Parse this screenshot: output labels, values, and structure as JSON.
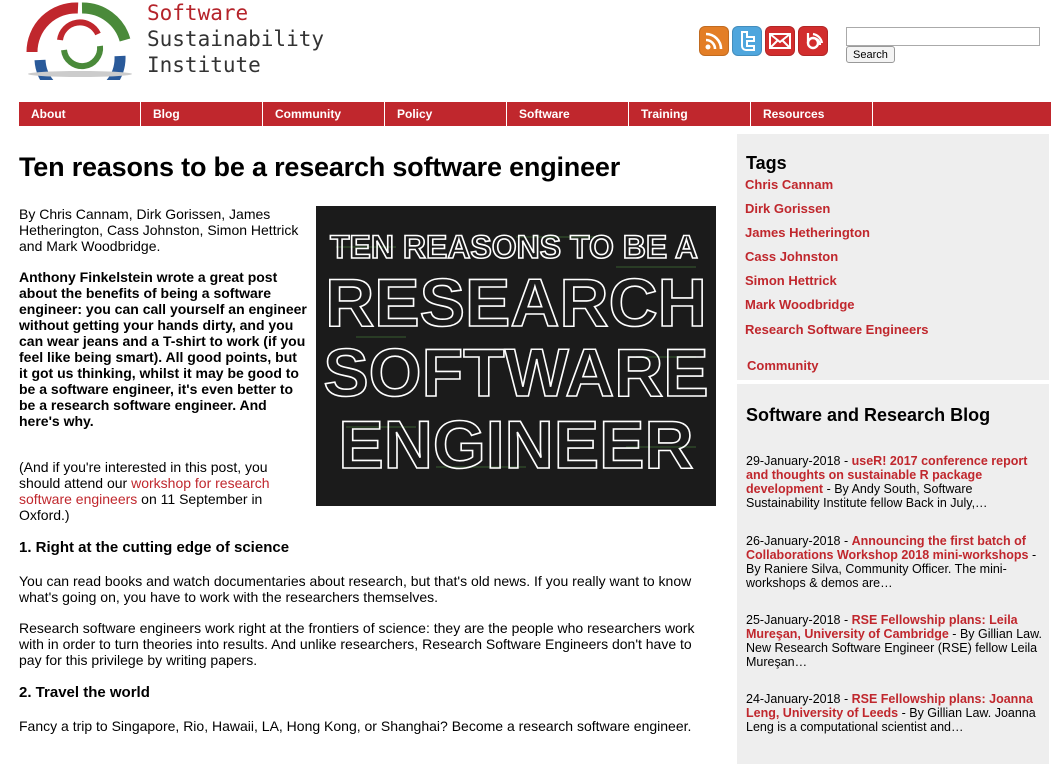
{
  "site": {
    "name_line1": "Software",
    "name_line2": "Sustainability",
    "name_line3": "Institute"
  },
  "social": [
    {
      "icon": "rss-icon",
      "color": "#e37e26"
    },
    {
      "icon": "twitter-icon",
      "color": "#4fa6dd"
    },
    {
      "icon": "email-icon",
      "color": "#d22d2d"
    },
    {
      "icon": "blog-icon",
      "color": "#d22d2d"
    }
  ],
  "search": {
    "placeholder": "",
    "button_label": "Search"
  },
  "nav": [
    "About",
    "Blog",
    "Community",
    "Policy",
    "Software",
    "Training",
    "Resources"
  ],
  "article": {
    "title": "Ten reasons to be a research software engineer",
    "byline": "By Chris Cannam, Dirk Gorissen, James Hetherington, Cass Johnston, Simon Hettrick and Mark Woodbridge.",
    "intro": "Anthony Finkelstein wrote a great post about the benefits of being a software engineer: you can call yourself an engineer without getting your hands dirty, and you can wear jeans and a T-shirt to work (if you feel like being smart). All good points, but it got us thinking, whilst it may be good to be a software engineer, it's even better to be a research software engineer. And here's why.",
    "aside_pre": "(And if you're interested in this post, you should attend our ",
    "aside_link": "workshop for research software engineers",
    "aside_post": " on 11 September in Oxford.)",
    "hero": {
      "line1": "TEN REASONS TO BE A",
      "line2": "RESEARCH",
      "line3": "SOFTWARE",
      "line4": "ENGINEER"
    },
    "section1_title": "1. Right at the cutting edge of science",
    "section1_p1": "You can read books and watch documentaries about research, but that's old news. If you really want to know what's going on, you have to work with the researchers themselves.",
    "section1_p2": "Research software engineers work right at the frontiers of science: they are the people who researchers work with in order to turn theories into results. And unlike researchers, Research Software Engineers don't have to pay for this privilege by writing papers.",
    "section2_title": "2. Travel the world",
    "section2_p1": "Fancy a trip to Singapore, Rio, Hawaii, LA, Hong Kong, or Shanghai? Become a research software engineer."
  },
  "sidebar": {
    "tags_title": "Tags",
    "tags": [
      "Chris Cannam",
      "Dirk Gorissen",
      "James Hetherington",
      "Cass Johnston",
      "Simon Hettrick",
      "Mark Woodbridge",
      "Research Software Engineers"
    ],
    "community_link": "Community",
    "blog_title": "Software and Research Blog",
    "posts": [
      {
        "date": "29-January-2018 - ",
        "title": "useR! 2017 conference report and thoughts on sustainable R package development",
        "sep": " - ",
        "excerpt": "By Andy South, Software Sustainability Institute fellow Back in July,…"
      },
      {
        "date": "26-January-2018 - ",
        "title": "Announcing the first batch of Collaborations Workshop 2018 mini-workshops",
        "sep": " - ",
        "excerpt": "By Raniere Silva, Community Officer. The mini-workshops & demos are…"
      },
      {
        "date": "25-January-2018 - ",
        "title": "RSE Fellowship plans: Leila Mureşan, University of Cambridge",
        "sep": " - ",
        "excerpt": "By Gillian Law. New Research Software Engineer (RSE) fellow Leila Mureşan…"
      },
      {
        "date": "24-January-2018 - ",
        "title": "RSE Fellowship plans: Joanna Leng, University of Leeds",
        "sep": " - ",
        "excerpt": "By Gillian Law. Joanna Leng is a computational scientist and…"
      }
    ]
  }
}
